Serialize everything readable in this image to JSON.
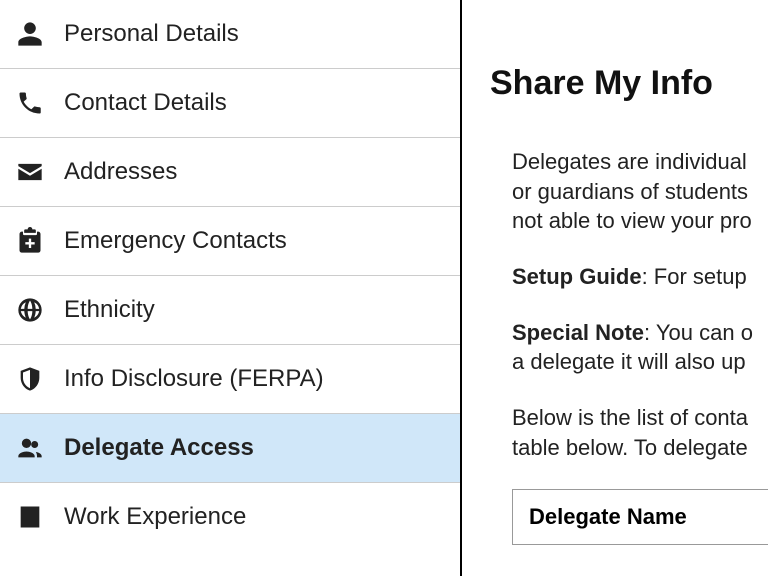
{
  "sidebar": {
    "items": [
      {
        "label": "Personal Details"
      },
      {
        "label": "Contact Details"
      },
      {
        "label": "Addresses"
      },
      {
        "label": "Emergency Contacts"
      },
      {
        "label": "Ethnicity"
      },
      {
        "label": "Info Disclosure (FERPA)"
      },
      {
        "label": "Delegate Access"
      },
      {
        "label": "Work Experience"
      }
    ]
  },
  "main": {
    "heading": "Share My Info",
    "p1a": "Delegates are individual",
    "p1b": "or guardians of students",
    "p1c": "not able to view your pro",
    "setup_label": "Setup Guide",
    "setup_text": ": For setup",
    "special_label": "Special Note",
    "special_text_a": ": You can o",
    "special_text_b": "a delegate it will also up",
    "p4a": "Below is the list of conta",
    "p4b": "table below. To delegate",
    "table": {
      "header": "Delegate Name"
    }
  }
}
